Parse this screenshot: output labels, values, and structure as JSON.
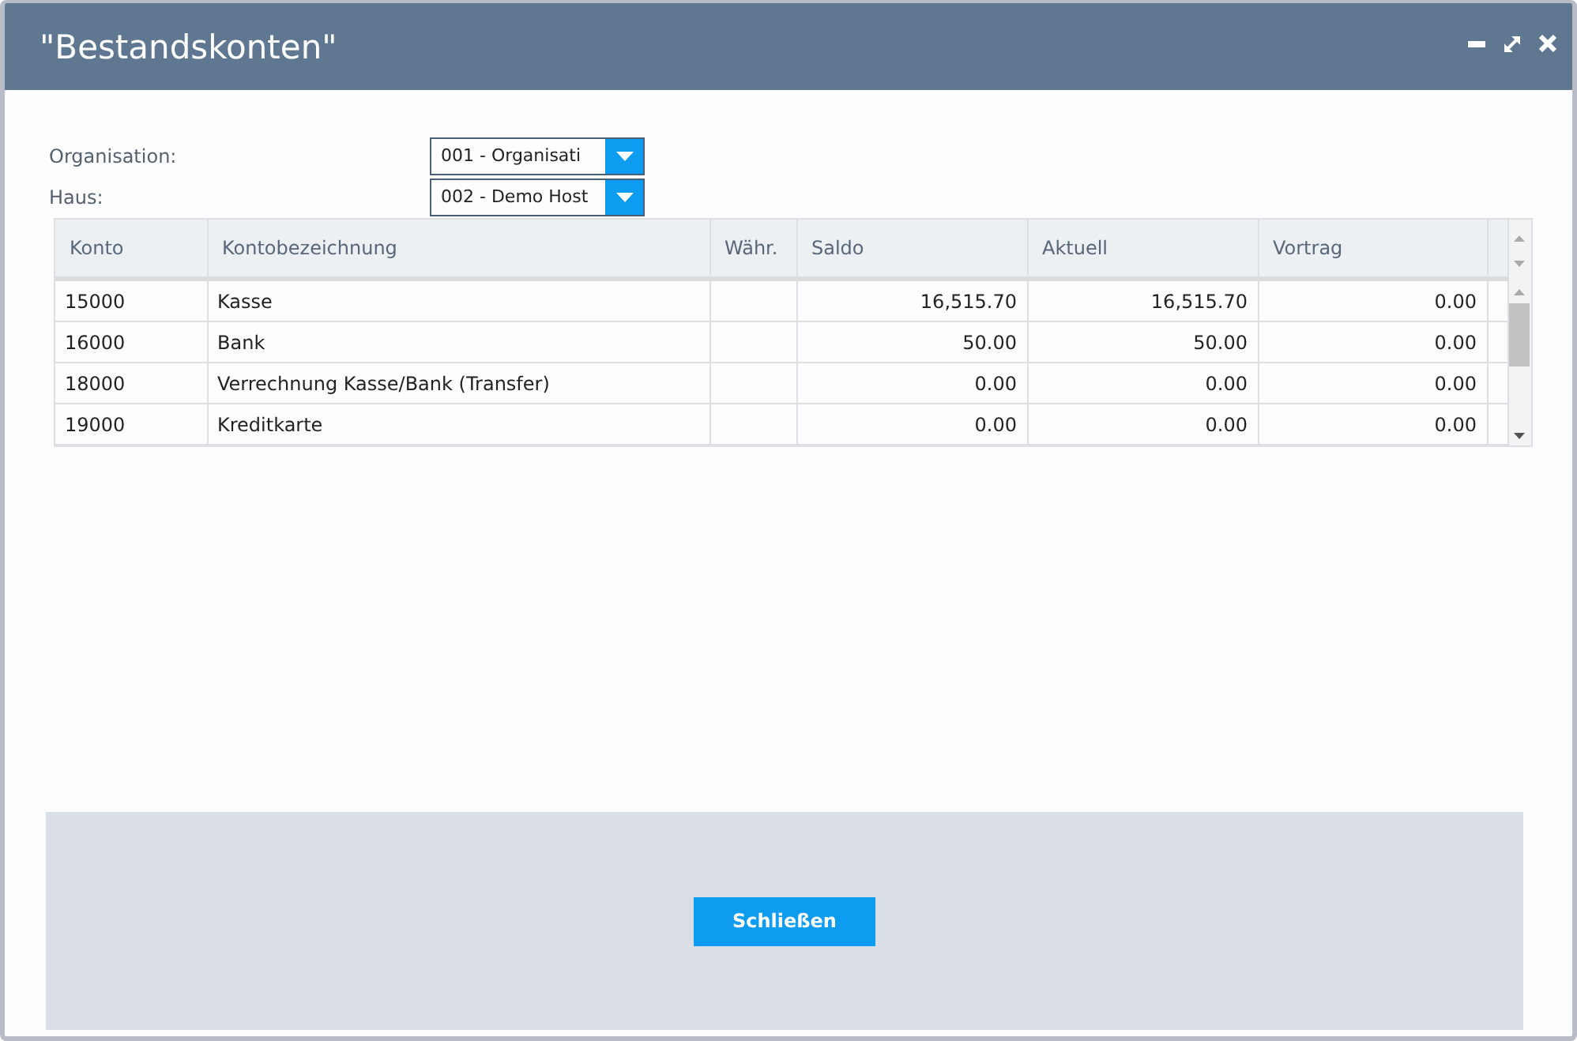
{
  "window": {
    "title": "\"Bestandskonten\""
  },
  "form": [
    {
      "label": "Organisation:",
      "value": "001 - Organisati"
    },
    {
      "label": "Haus:",
      "value": "002 - Demo Host"
    }
  ],
  "table": {
    "columns": [
      {
        "label": "Konto",
        "kind": "text"
      },
      {
        "label": "Kontobezeichnung",
        "kind": "text"
      },
      {
        "label": "Währ.",
        "kind": "text"
      },
      {
        "label": "Saldo",
        "kind": "amount"
      },
      {
        "label": "Aktuell",
        "kind": "amount"
      },
      {
        "label": "Vortrag",
        "kind": "amount"
      }
    ],
    "rows": [
      [
        "15000",
        "Kasse",
        "",
        "16,515.70",
        "16,515.70",
        "0.00"
      ],
      [
        "16000",
        "Bank",
        "",
        "50.00",
        "50.00",
        "0.00"
      ],
      [
        "18000",
        "Verrechnung Kasse/Bank (Transfer)",
        "",
        "0.00",
        "0.00",
        "0.00"
      ],
      [
        "19000",
        "Kreditkarte",
        "",
        "0.00",
        "0.00",
        "0.00"
      ]
    ]
  },
  "buttons": [
    "Schließen"
  ]
}
